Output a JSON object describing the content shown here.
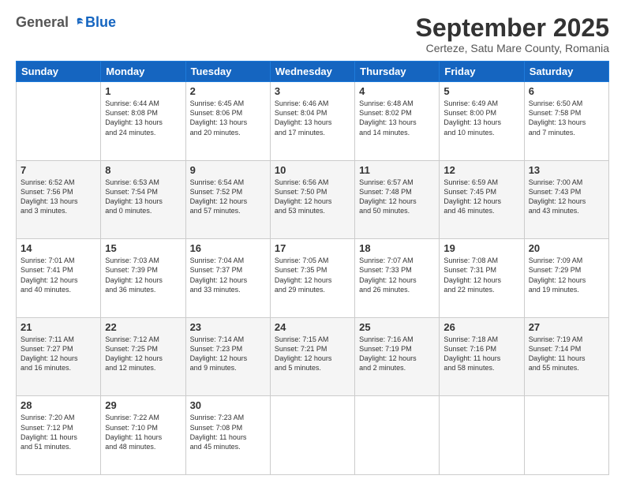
{
  "header": {
    "logo_general": "General",
    "logo_blue": "Blue",
    "month_title": "September 2025",
    "location": "Certeze, Satu Mare County, Romania"
  },
  "days_of_week": [
    "Sunday",
    "Monday",
    "Tuesday",
    "Wednesday",
    "Thursday",
    "Friday",
    "Saturday"
  ],
  "weeks": [
    [
      {
        "day": "",
        "info": ""
      },
      {
        "day": "1",
        "info": "Sunrise: 6:44 AM\nSunset: 8:08 PM\nDaylight: 13 hours\nand 24 minutes."
      },
      {
        "day": "2",
        "info": "Sunrise: 6:45 AM\nSunset: 8:06 PM\nDaylight: 13 hours\nand 20 minutes."
      },
      {
        "day": "3",
        "info": "Sunrise: 6:46 AM\nSunset: 8:04 PM\nDaylight: 13 hours\nand 17 minutes."
      },
      {
        "day": "4",
        "info": "Sunrise: 6:48 AM\nSunset: 8:02 PM\nDaylight: 13 hours\nand 14 minutes."
      },
      {
        "day": "5",
        "info": "Sunrise: 6:49 AM\nSunset: 8:00 PM\nDaylight: 13 hours\nand 10 minutes."
      },
      {
        "day": "6",
        "info": "Sunrise: 6:50 AM\nSunset: 7:58 PM\nDaylight: 13 hours\nand 7 minutes."
      }
    ],
    [
      {
        "day": "7",
        "info": "Sunrise: 6:52 AM\nSunset: 7:56 PM\nDaylight: 13 hours\nand 3 minutes."
      },
      {
        "day": "8",
        "info": "Sunrise: 6:53 AM\nSunset: 7:54 PM\nDaylight: 13 hours\nand 0 minutes."
      },
      {
        "day": "9",
        "info": "Sunrise: 6:54 AM\nSunset: 7:52 PM\nDaylight: 12 hours\nand 57 minutes."
      },
      {
        "day": "10",
        "info": "Sunrise: 6:56 AM\nSunset: 7:50 PM\nDaylight: 12 hours\nand 53 minutes."
      },
      {
        "day": "11",
        "info": "Sunrise: 6:57 AM\nSunset: 7:48 PM\nDaylight: 12 hours\nand 50 minutes."
      },
      {
        "day": "12",
        "info": "Sunrise: 6:59 AM\nSunset: 7:45 PM\nDaylight: 12 hours\nand 46 minutes."
      },
      {
        "day": "13",
        "info": "Sunrise: 7:00 AM\nSunset: 7:43 PM\nDaylight: 12 hours\nand 43 minutes."
      }
    ],
    [
      {
        "day": "14",
        "info": "Sunrise: 7:01 AM\nSunset: 7:41 PM\nDaylight: 12 hours\nand 40 minutes."
      },
      {
        "day": "15",
        "info": "Sunrise: 7:03 AM\nSunset: 7:39 PM\nDaylight: 12 hours\nand 36 minutes."
      },
      {
        "day": "16",
        "info": "Sunrise: 7:04 AM\nSunset: 7:37 PM\nDaylight: 12 hours\nand 33 minutes."
      },
      {
        "day": "17",
        "info": "Sunrise: 7:05 AM\nSunset: 7:35 PM\nDaylight: 12 hours\nand 29 minutes."
      },
      {
        "day": "18",
        "info": "Sunrise: 7:07 AM\nSunset: 7:33 PM\nDaylight: 12 hours\nand 26 minutes."
      },
      {
        "day": "19",
        "info": "Sunrise: 7:08 AM\nSunset: 7:31 PM\nDaylight: 12 hours\nand 22 minutes."
      },
      {
        "day": "20",
        "info": "Sunrise: 7:09 AM\nSunset: 7:29 PM\nDaylight: 12 hours\nand 19 minutes."
      }
    ],
    [
      {
        "day": "21",
        "info": "Sunrise: 7:11 AM\nSunset: 7:27 PM\nDaylight: 12 hours\nand 16 minutes."
      },
      {
        "day": "22",
        "info": "Sunrise: 7:12 AM\nSunset: 7:25 PM\nDaylight: 12 hours\nand 12 minutes."
      },
      {
        "day": "23",
        "info": "Sunrise: 7:14 AM\nSunset: 7:23 PM\nDaylight: 12 hours\nand 9 minutes."
      },
      {
        "day": "24",
        "info": "Sunrise: 7:15 AM\nSunset: 7:21 PM\nDaylight: 12 hours\nand 5 minutes."
      },
      {
        "day": "25",
        "info": "Sunrise: 7:16 AM\nSunset: 7:19 PM\nDaylight: 12 hours\nand 2 minutes."
      },
      {
        "day": "26",
        "info": "Sunrise: 7:18 AM\nSunset: 7:16 PM\nDaylight: 11 hours\nand 58 minutes."
      },
      {
        "day": "27",
        "info": "Sunrise: 7:19 AM\nSunset: 7:14 PM\nDaylight: 11 hours\nand 55 minutes."
      }
    ],
    [
      {
        "day": "28",
        "info": "Sunrise: 7:20 AM\nSunset: 7:12 PM\nDaylight: 11 hours\nand 51 minutes."
      },
      {
        "day": "29",
        "info": "Sunrise: 7:22 AM\nSunset: 7:10 PM\nDaylight: 11 hours\nand 48 minutes."
      },
      {
        "day": "30",
        "info": "Sunrise: 7:23 AM\nSunset: 7:08 PM\nDaylight: 11 hours\nand 45 minutes."
      },
      {
        "day": "",
        "info": ""
      },
      {
        "day": "",
        "info": ""
      },
      {
        "day": "",
        "info": ""
      },
      {
        "day": "",
        "info": ""
      }
    ]
  ]
}
